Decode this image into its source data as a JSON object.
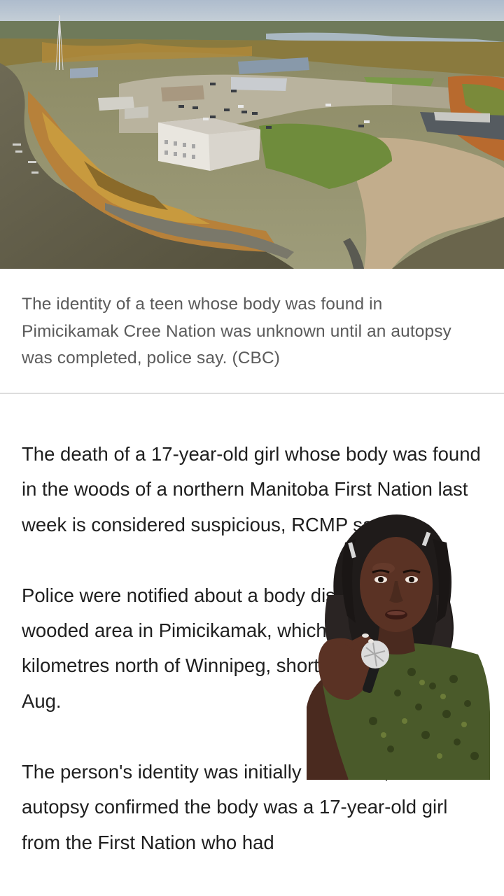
{
  "hero_image": {
    "icon": "aerial-photo-of-riverside-community"
  },
  "caption": {
    "text": "The identity of a teen whose body was found in Pimicikamak Cree Nation was unknown until an autopsy was completed, police say. (CBC)"
  },
  "article": {
    "paragraphs": [
      "The death of a 17-year-old girl whose body was found in the woods of a northern Manitoba First Nation last week is considered suspicious, RCMP say.",
      "Police were notified about a body discovered in a wooded area in Pimicikamak, which is about 530 kilometres north of Winnipeg, shortly before 2 p.m. on Aug.",
      "The person's identity was initially unknown, but an autopsy confirmed the body was a 17-year-old girl from the First Nation who had"
    ]
  },
  "creator_overlay": {
    "icon": "presenter-with-microphone"
  },
  "colors": {
    "background": "#ffffff",
    "caption_text": "#5b5b5b",
    "body_text": "#1f1f1f",
    "divider": "#dddddd"
  }
}
